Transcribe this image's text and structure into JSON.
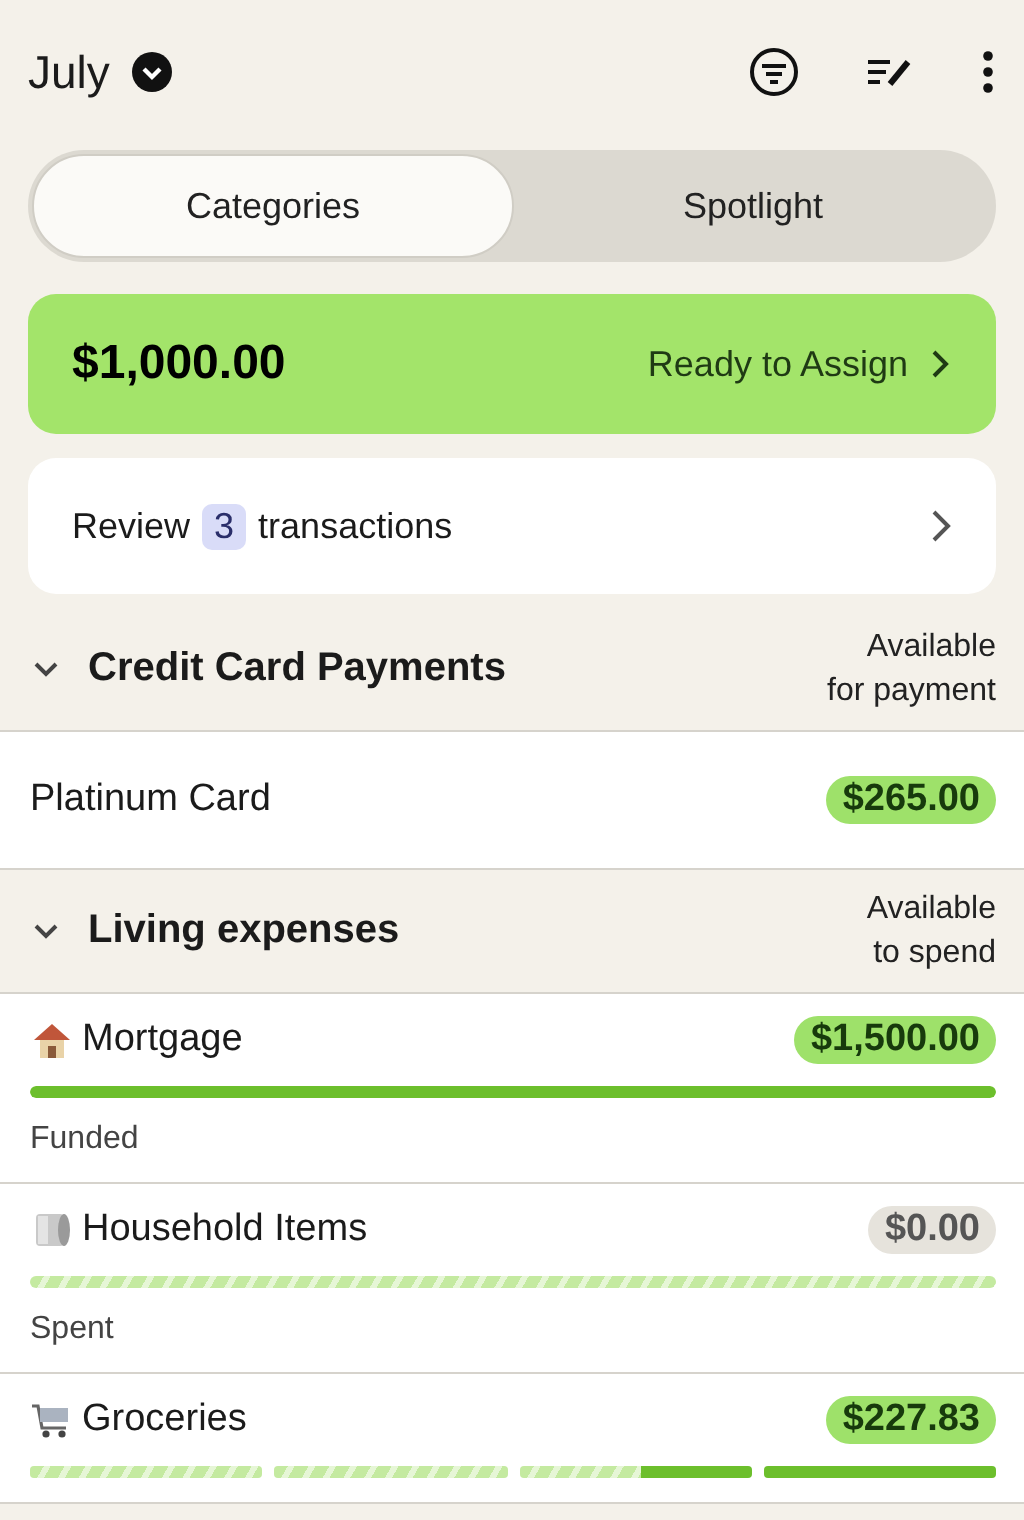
{
  "header": {
    "month": "July"
  },
  "tabs": [
    {
      "label": "Categories",
      "selected": true
    },
    {
      "label": "Spotlight",
      "selected": false
    }
  ],
  "ready_to_assign": {
    "amount": "$1,000.00",
    "label": "Ready to Assign"
  },
  "review": {
    "before": "Review",
    "count": "3",
    "after": "transactions"
  },
  "groups": [
    {
      "name": "Credit Card Payments",
      "expanded": true,
      "available_label": [
        "Available",
        "for payment"
      ],
      "categories": [
        {
          "name": "Platinum Card",
          "amount": "$265.00",
          "positive": true,
          "kind": "plain"
        }
      ]
    },
    {
      "name": "Living expenses",
      "expanded": true,
      "available_label": [
        "Available",
        "to spend"
      ],
      "categories": [
        {
          "name": "Mortgage",
          "amount": "$1,500.00",
          "positive": true,
          "kind": "funded",
          "level": 1,
          "status": "Funded"
        },
        {
          "name": "Household Items",
          "amount": "$0.00",
          "positive": false,
          "kind": "striped",
          "status": "Spent"
        },
        {
          "name": "Groceries",
          "amount": "$227.83",
          "positive": true,
          "kind": "segmented"
        }
      ]
    }
  ]
}
